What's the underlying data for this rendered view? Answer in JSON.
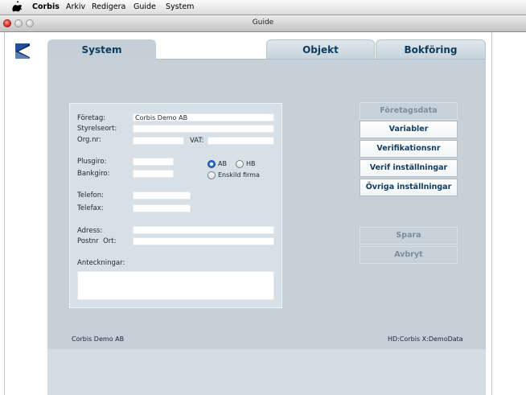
{
  "menubar": {
    "app": "Corbis",
    "items": [
      "Arkiv",
      "Redigera",
      "Guide",
      "System"
    ]
  },
  "window": {
    "title": "Guide"
  },
  "tabs": [
    {
      "label": "System",
      "active": true
    },
    {
      "label": "Objekt",
      "active": false
    },
    {
      "label": "Bokföring",
      "active": false
    }
  ],
  "form": {
    "foretag_label": "Företag:",
    "foretag_value": "Corbis Demo AB",
    "styrelseort_label": "Styrelseort:",
    "styrelseort_value": "",
    "orgnr_label": "Org.nr:",
    "orgnr_value": "",
    "vat_label": "VAT:",
    "vat_value": "",
    "plusgiro_label": "Plusgiro:",
    "plusgiro_value": "",
    "bankgiro_label": "Bankgiro:",
    "bankgiro_value": "",
    "radio_ab": "AB",
    "radio_hb": "HB",
    "radio_enskild": "Enskild firma",
    "selected_company_form": "AB",
    "telefon_label": "Telefon:",
    "telefon_value": "",
    "telefax_label": "Telefax:",
    "telefax_value": "",
    "adress_label": "Adress:",
    "adress_value": "",
    "postnr_label": "Postnr  Ort:",
    "postnr_value": "",
    "anteckningar_label": "Anteckningar:",
    "anteckningar_value": ""
  },
  "side_buttons": {
    "foretagsdata": "Företagsdata",
    "variabler": "Variabler",
    "verifikationsnr": "Verifikationsnr",
    "verif_installningar": "Verif inställningar",
    "ovriga_installningar": "Övriga inställningar"
  },
  "actions": {
    "spara": "Spara",
    "avbryt": "Avbryt"
  },
  "status": {
    "company": "Corbis Demo AB",
    "path": "HD:Corbis X:DemoData"
  },
  "colors": {
    "panel": "#c5d0d8",
    "tab_text": "#0f3b5a",
    "button_text": "#123e63",
    "radio_selected": "#1d5fb8"
  }
}
